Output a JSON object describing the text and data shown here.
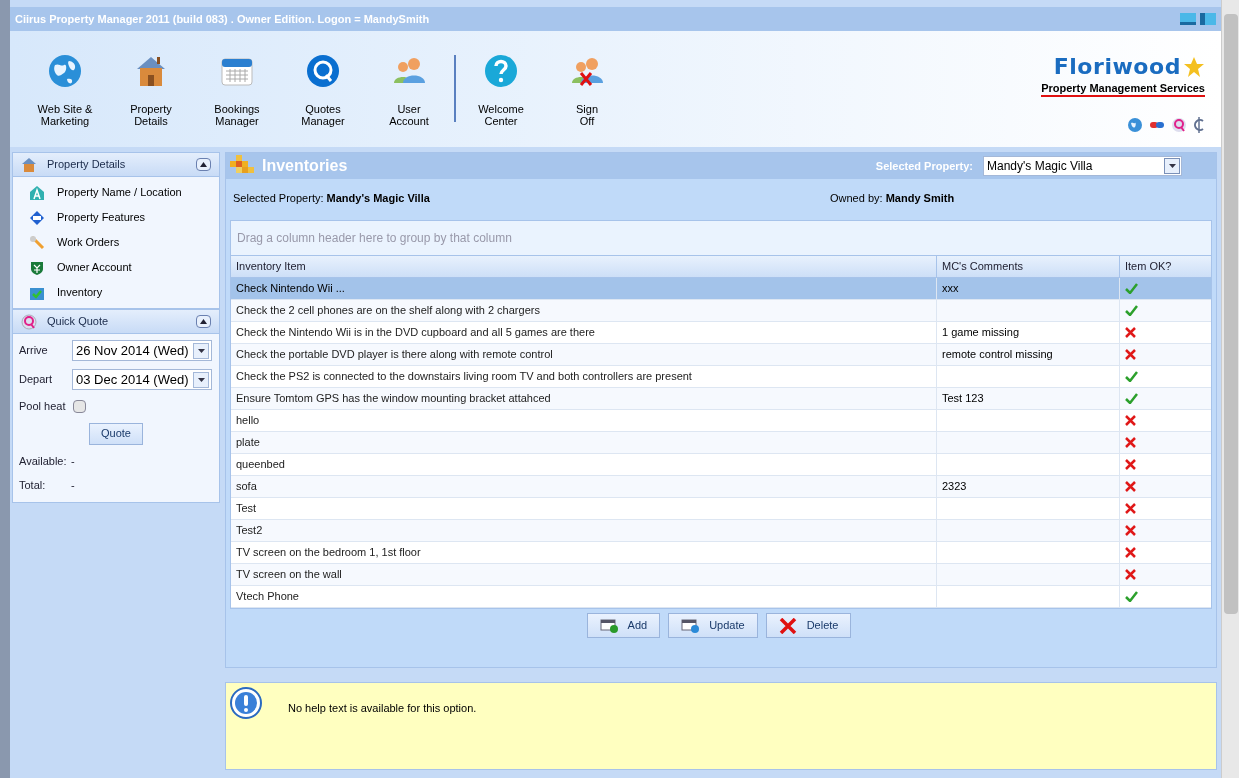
{
  "window": {
    "title": "Ciirus Property Manager 2011 (build 083) . Owner Edition. Logon = MandySmith"
  },
  "toolbar": {
    "groups": [
      [
        {
          "kind": "globe",
          "label": "Web Site &\nMarketing"
        },
        {
          "kind": "house",
          "label": "Property\nDetails"
        },
        {
          "kind": "calendar",
          "label": "Bookings\nManager"
        },
        {
          "kind": "q",
          "label": "Quotes\nManager"
        },
        {
          "kind": "users",
          "label": "User\nAccount"
        }
      ],
      [
        {
          "kind": "help",
          "label": "Welcome\nCenter"
        },
        {
          "kind": "signoff",
          "label": "Sign\nOff"
        }
      ]
    ]
  },
  "logo": {
    "name": "Floriwood",
    "tagline": "Property Management Services"
  },
  "sidebar": {
    "panels": [
      {
        "title": "Property Details",
        "kind": "house",
        "expanded": true,
        "items": [
          {
            "kind": "letter-a",
            "label": "Property Name / Location"
          },
          {
            "kind": "features",
            "label": "Property Features"
          },
          {
            "kind": "wrench",
            "label": "Work Orders"
          },
          {
            "kind": "shield",
            "label": "Owner Account"
          },
          {
            "kind": "check",
            "label": "Inventory"
          }
        ]
      },
      {
        "title": "Quick Quote",
        "kind": "q",
        "expanded": true,
        "quote": {
          "arrive_label": "Arrive",
          "arrive": "26 Nov 2014 (Wed)",
          "depart_label": "Depart",
          "depart": "03 Dec 2014 (Wed)",
          "pool_label": "Pool heat",
          "pool_checked": false,
          "button": "Quote",
          "available_label": "Available:",
          "available": "-",
          "total_label": "Total:",
          "total": "-"
        }
      }
    ]
  },
  "main": {
    "title": "Inventories",
    "selector_label": "Selected Property:",
    "selector_value": "Mandy's Magic Villa",
    "property_label": "Selected Property:",
    "property": "Mandy's Magic Villa",
    "owner_label": "Owned by:",
    "owner": "Mandy Smith",
    "group_hint": "Drag a column header here to group by that column",
    "columns": [
      "Inventory Item",
      "MC's Comments",
      "Item OK?"
    ],
    "rows": [
      {
        "item": "Check Nintendo Wii ...",
        "comment": "xxx",
        "ok": true,
        "selected": true
      },
      {
        "item": "Check the 2 cell phones are on the shelf along with 2 chargers",
        "comment": "",
        "ok": true,
        "selected": false
      },
      {
        "item": "Check the Nintendo Wii is in the DVD cupboard and all 5 games are there",
        "comment": "1 game missing",
        "ok": false,
        "selected": false
      },
      {
        "item": "Check the portable DVD player is there along with remote control",
        "comment": "remote control missing",
        "ok": false,
        "selected": false
      },
      {
        "item": "Check the PS2 is connected to the downstairs living room TV and both controllers are present",
        "comment": "",
        "ok": true,
        "selected": false
      },
      {
        "item": "Ensure Tomtom GPS has the window mounting bracket attahced",
        "comment": "Test 123",
        "ok": true,
        "selected": false
      },
      {
        "item": "hello",
        "comment": "",
        "ok": false,
        "selected": false
      },
      {
        "item": "plate",
        "comment": "",
        "ok": false,
        "selected": false
      },
      {
        "item": "queenbed",
        "comment": "",
        "ok": false,
        "selected": false
      },
      {
        "item": "sofa",
        "comment": "2323",
        "ok": false,
        "selected": false
      },
      {
        "item": "Test",
        "comment": "",
        "ok": false,
        "selected": false
      },
      {
        "item": "Test2",
        "comment": "",
        "ok": false,
        "selected": false
      },
      {
        "item": "TV screen on the bedroom 1, 1st floor",
        "comment": "",
        "ok": false,
        "selected": false
      },
      {
        "item": "TV screen on the wall",
        "comment": "",
        "ok": false,
        "selected": false
      },
      {
        "item": "Vtech Phone",
        "comment": "",
        "ok": true,
        "selected": false
      }
    ],
    "buttons": [
      {
        "kind": "add",
        "label": "Add"
      },
      {
        "kind": "update",
        "label": "Update"
      },
      {
        "kind": "delete",
        "label": "Delete"
      }
    ],
    "help": "No help text is available for this option."
  }
}
